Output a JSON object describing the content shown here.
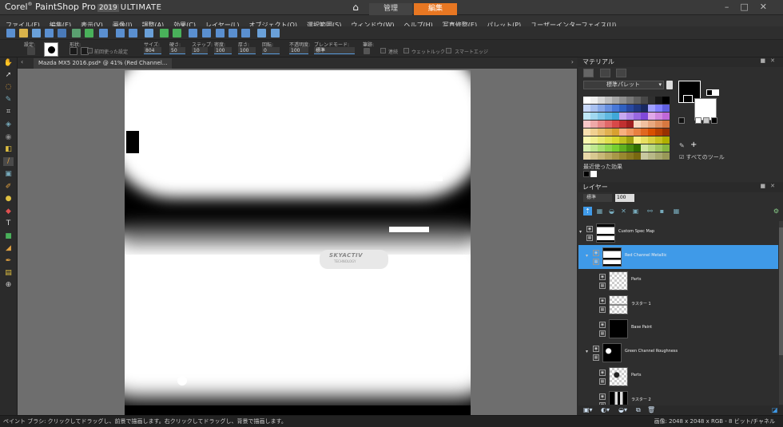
{
  "app": {
    "brand": "Corel",
    "name": "PaintShop Pro",
    "version": "2019",
    "edition": "ULTIMATE"
  },
  "workspace_tabs": [
    {
      "label": "管理",
      "active": false
    },
    {
      "label": "編集",
      "active": true
    }
  ],
  "accent_color": "#e87722",
  "menu": [
    "ファイル(F)",
    "編集(E)",
    "表示(V)",
    "画像(I)",
    "調整(A)",
    "効果(C)",
    "レイヤー(L)",
    "オブジェクト(O)",
    "選択範囲(S)",
    "ウィンドウ(W)",
    "ヘルプ(H)",
    "写真修整(E)",
    "パレット(P)",
    "ユーザーインターフェイス(U)"
  ],
  "tool_options": {
    "preset_label": "設定:",
    "shape_label": "形状:",
    "size_label": "サイズ:",
    "size_value": "804",
    "hardness_label": "硬さ:",
    "hardness_value": "50",
    "step_label": "ステップ:",
    "step_value": "10",
    "density_label": "密度:",
    "density_value": "100",
    "thickness_label": "厚さ:",
    "thickness_value": "100",
    "rotation_label": "回転:",
    "rotation_value": "0",
    "opacity_label": "不透明度:",
    "opacity_value": "100",
    "blend_label": "ブレンドモード:",
    "blend_value": "標準",
    "stroke_label": "筆跡:",
    "last_used": "前回使った設定",
    "continuous": "連続",
    "wet_look": "ウェットルック",
    "smart_edge": "スマートエッジ"
  },
  "document_tab": "Mazda MX5 2016.psd* @ 41% (Red Channel...",
  "canvas_text": {
    "skyactiv": "SKYACTIV",
    "subtitle": "TECHNOLOGY"
  },
  "materials": {
    "title": "マテリアル",
    "palette_name": "標準パレット",
    "recent_label": "最近使った効果",
    "all_tools": "すべてのツール",
    "foreground": "#000000",
    "background": "#ffffff"
  },
  "layers_panel": {
    "title": "レイヤー",
    "blend": "標準",
    "opacity": "100",
    "items": [
      {
        "name": "Custom Spec Map",
        "indent": 0,
        "expanded": true,
        "group": true,
        "selected": false,
        "thumb": "white-shape"
      },
      {
        "name": "Red Channel Metallic",
        "indent": 1,
        "expanded": true,
        "group": true,
        "selected": true,
        "thumb": "white-shape"
      },
      {
        "name": "Parts",
        "indent": 2,
        "expanded": false,
        "group": false,
        "selected": false,
        "thumb": "transparent"
      },
      {
        "name": "ラスター 1",
        "indent": 2,
        "expanded": false,
        "group": false,
        "selected": false,
        "thumb": "transparent-line"
      },
      {
        "name": "Base Paint",
        "indent": 2,
        "expanded": false,
        "group": false,
        "selected": false,
        "thumb": "black"
      },
      {
        "name": "Green Channel Roughness",
        "indent": 1,
        "expanded": true,
        "group": true,
        "selected": false,
        "thumb": "mixed"
      },
      {
        "name": "Parts",
        "indent": 2,
        "expanded": false,
        "group": false,
        "selected": false,
        "thumb": "transparent-parts"
      },
      {
        "name": "ラスター 2",
        "indent": 2,
        "expanded": false,
        "group": false,
        "selected": false,
        "thumb": "dark-parts"
      }
    ]
  },
  "status": {
    "hint": "ペイント ブラシ: クリックしてドラッグし、前景で描画します。右クリックしてドラッグし、背景で描画します。",
    "image_info": "画像: 2048 x 2048 x RGB - 8 ビット/チャネル"
  }
}
